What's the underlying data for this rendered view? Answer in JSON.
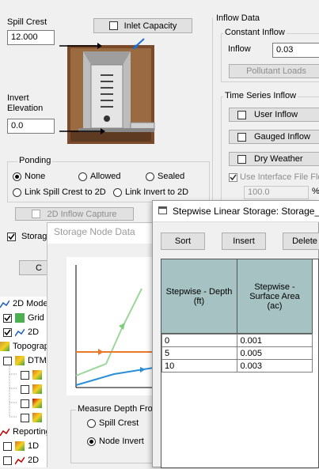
{
  "main_form": {
    "spill_crest_label": "Spill Crest",
    "spill_crest_value": "12.000",
    "inlet_capacity_label": "Inlet Capacity",
    "invert_label_line1": "Invert",
    "invert_label_line2": "Elevation",
    "invert_value": "0.0",
    "ponding": {
      "title": "Ponding",
      "options": [
        "None",
        "Allowed",
        "Sealed",
        "Link Spill Crest to 2D",
        "Link Invert to 2D"
      ],
      "selected": "None"
    },
    "inflow_2d_capture_label": "2D Inflow Capture",
    "storage_check_label": "Storag",
    "storage_button_label": "C"
  },
  "inflow_data": {
    "title": "Inflow Data",
    "constant_title": "Constant Inflow",
    "inflow_label": "Inflow",
    "inflow_value": "0.03",
    "pollutant_loads_label": "Pollutant Loads",
    "time_series_title": "Time Series Inflow",
    "user_inflow_label": "User Inflow",
    "gauged_inflow_label": "Gauged Inflow",
    "dry_weather_label": "Dry Weather",
    "interface_file_label": "Use Interface File Flo",
    "interface_file_value": "100.0",
    "percent_label": "%"
  },
  "tree": [
    {
      "label": "2D Mode",
      "indent": 0,
      "check": "none",
      "icon": "map-icon",
      "icon_color": "#1f5fbf"
    },
    {
      "label": "Grid",
      "indent": 1,
      "check": "checked",
      "icon": "grid-icon",
      "icon_color": "#4caf50"
    },
    {
      "label": "2D",
      "indent": 1,
      "check": "checked",
      "icon": "flow-icon",
      "icon_color": "#1f5fbf"
    },
    {
      "label": "Topograp",
      "indent": 0,
      "check": "none",
      "icon": "topography-icon",
      "icon_color": "#c89b3c"
    },
    {
      "label": "DTM",
      "indent": 1,
      "check": "unchecked",
      "icon": "dtm-icon",
      "icon_color": "#d9a020"
    },
    {
      "label": "",
      "indent": 2,
      "check": "unchecked",
      "icon": "raster-icon",
      "icon_color": "#e07020"
    },
    {
      "label": "",
      "indent": 2,
      "check": "unchecked",
      "icon": "raster-icon",
      "icon_color": "#e07020"
    },
    {
      "label": "",
      "indent": 2,
      "check": "unchecked",
      "icon": "raster-red-icon",
      "icon_color": "#c00000"
    },
    {
      "label": "",
      "indent": 2,
      "check": "unchecked",
      "icon": "raster-icon",
      "icon_color": "#e07020"
    },
    {
      "label": "Reporting",
      "indent": 0,
      "check": "none",
      "icon": "chart-icon",
      "icon_color": "#c00000"
    },
    {
      "label": "1D",
      "indent": 1,
      "check": "unchecked",
      "icon": "raster-icon",
      "icon_color": "#e07020"
    },
    {
      "label": "2D",
      "indent": 1,
      "check": "unchecked",
      "icon": "chart-icon",
      "icon_color": "#c00000"
    }
  ],
  "storage_node_dialog": {
    "title": "Storage Node Data",
    "measure_depth_title": "Measure Depth From",
    "options": [
      "Spill Crest",
      "Node Invert"
    ],
    "selected": "Node Invert"
  },
  "stepwise_dialog": {
    "title": "Stepwise Linear Storage: Storage_fr",
    "buttons": [
      "Sort",
      "Insert",
      "Delete"
    ],
    "columns": [
      "Stepwise - Depth (ft)",
      "Stepwise - Surface Area (ac)"
    ],
    "rows": [
      [
        "0",
        "0.001"
      ],
      [
        "5",
        "0.005"
      ],
      [
        "10",
        "0.003"
      ]
    ],
    "header_color": "#a6c2c3"
  }
}
